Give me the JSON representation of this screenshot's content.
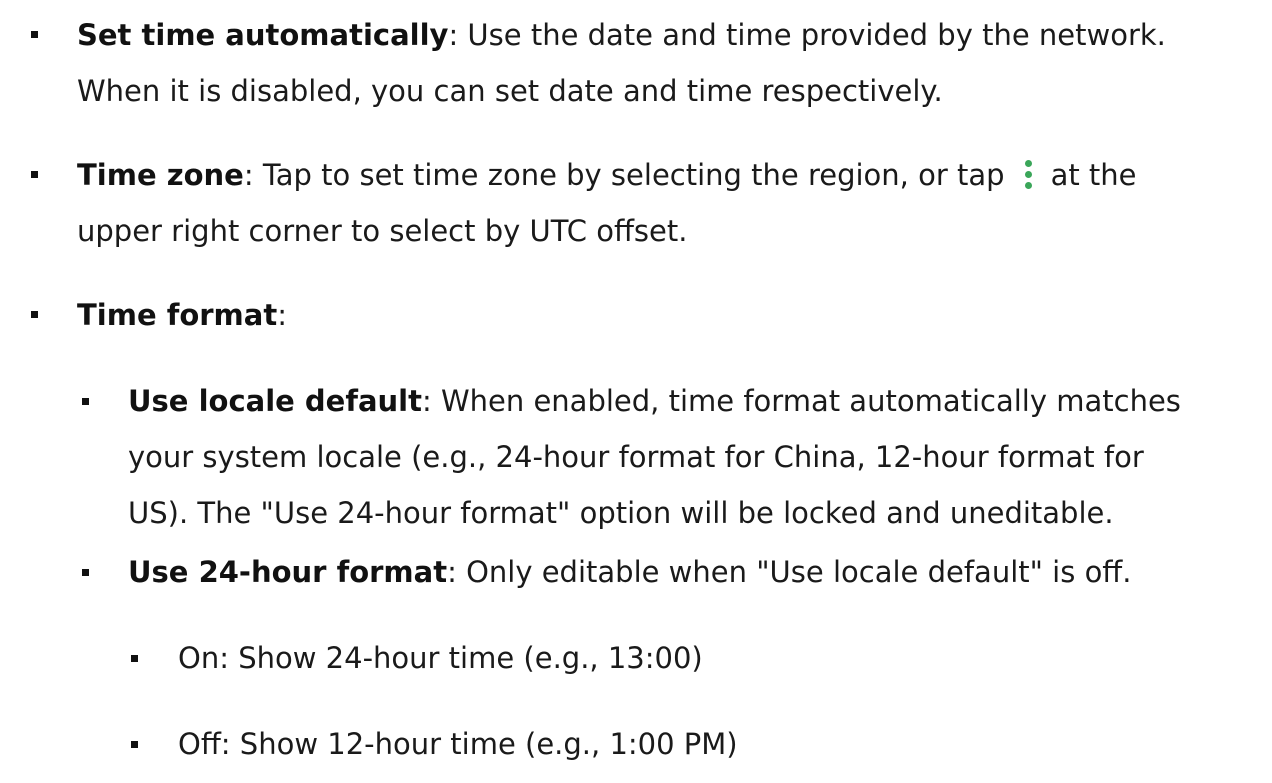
{
  "items": [
    {
      "bold": "Set time automatically",
      "line1": ": Use the date and time provided by the network.",
      "line2": "When it is disabled, you can set date and time respectively."
    },
    {
      "bold": "Time zone",
      "line1_before": ": Tap to set time zone by selecting the region, or tap",
      "line1_after": "at the",
      "line2": "upper right corner to select by UTC offset.",
      "icon": "more-vertical-icon",
      "icon_color": "#3aa659"
    },
    {
      "bold": "Time format",
      "after": ":"
    },
    {
      "bold": "Use locale default",
      "line1": ": When enabled, time format automatically matches",
      "line2": "your system locale (e.g., 24-hour format for China, 12-hour format for",
      "line3": "US). The \"Use 24-hour format\" option will be locked and uneditable."
    },
    {
      "bold": "Use 24-hour format",
      "line1": ": Only editable when \"Use locale default\" is off."
    },
    {
      "text": "On: Show 24-hour time (e.g., 13:00)"
    },
    {
      "text": "Off: Show 12-hour time (e.g., 1:00 PM)"
    }
  ]
}
